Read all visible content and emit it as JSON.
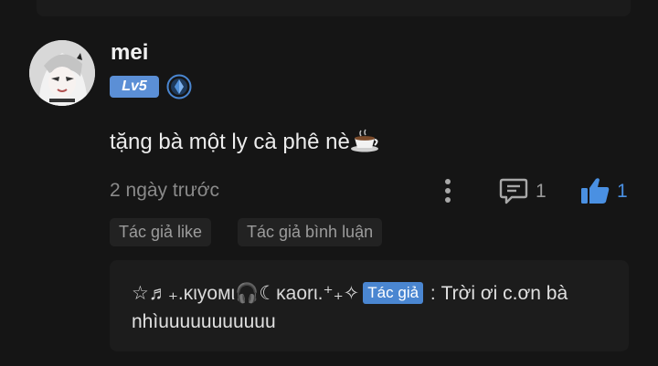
{
  "comment": {
    "username": "mei",
    "level": "Lv5",
    "text": "tặng bà một ly cà phê nè",
    "emoji": "coffee-cup",
    "time": "2 ngày trước",
    "reply_count": "1",
    "like_count": "1",
    "tags": [
      "Tác giả like",
      "Tác giả bình luận"
    ]
  },
  "reply": {
    "author_name": "☆♬₊.κιyoмι🎧☾κaorι.⁺₊✧",
    "author_badge": "Tác giả",
    "separator": " : ",
    "text_line1": "Trời ơi c.ơn bà",
    "text_line2": "nhìuuuuuuuuuuu"
  },
  "colors": {
    "background": "#151515",
    "accent_blue": "#4a90e2",
    "badge_blue": "#5b8fd6",
    "muted_text": "#8a8a8a"
  },
  "icons": {
    "rank": "diamond-rank-icon",
    "more": "vertical-dots-icon",
    "reply": "comment-bubble-icon",
    "like": "thumbs-up-icon"
  }
}
